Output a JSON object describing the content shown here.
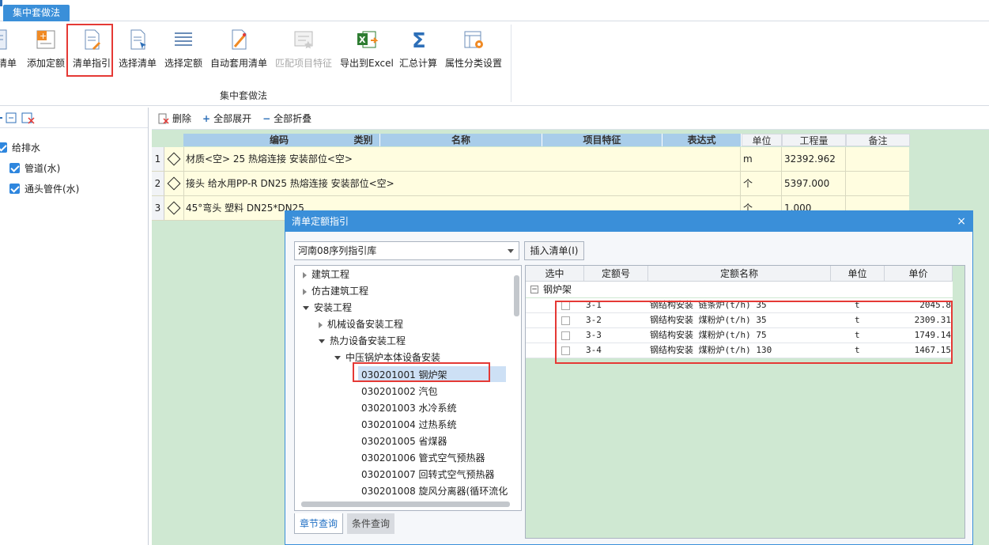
{
  "ribbon": {
    "tab": "集中套做法",
    "buttons": [
      {
        "label": "清单",
        "icon": "list-icon"
      },
      {
        "label": "添加定额",
        "icon": "add-quota-icon"
      },
      {
        "label": "清单指引",
        "icon": "list-guide-icon"
      },
      {
        "label": "选择清单",
        "icon": "select-list-icon"
      },
      {
        "label": "选择定额",
        "icon": "select-quota-icon"
      },
      {
        "label": "自动套用清单",
        "icon": "auto-apply-icon"
      },
      {
        "label": "匹配项目特征",
        "icon": "match-feature-icon"
      },
      {
        "label": "导出到Excel",
        "icon": "excel-icon"
      },
      {
        "label": "汇总计算",
        "icon": "sigma-icon"
      },
      {
        "label": "属性分类设置",
        "icon": "settings-table-icon"
      }
    ],
    "group_label": "集中套做法"
  },
  "left": {
    "items": [
      {
        "label": "给排水"
      },
      {
        "label": "管道(水)"
      },
      {
        "label": "通头管件(水)"
      }
    ]
  },
  "main": {
    "toolbar": {
      "delete": "删除",
      "expand": "全部展开",
      "collapse": "全部折叠"
    },
    "headers": {
      "code": "编码",
      "category": "类别",
      "name": "名称",
      "feature": "项目特征",
      "expr": "表达式",
      "unit": "单位",
      "qty": "工程量",
      "remark": "备注"
    },
    "rows": [
      {
        "num": "1",
        "name": "材质<空> 25 热熔连接 安装部位<空>",
        "unit": "m",
        "qty": "32392.962"
      },
      {
        "num": "2",
        "name": "接头 给水用PP-R DN25 热熔连接 安装部位<空>",
        "unit": "个",
        "qty": "5397.000"
      },
      {
        "num": "3",
        "name": "45°弯头 塑料 DN25*DN25",
        "unit": "个",
        "qty": "1.000"
      }
    ]
  },
  "dialog": {
    "title": "清单定额指引",
    "close": "×",
    "library": "河南08序列指引库",
    "insert": "插入清单(I)",
    "tree": {
      "n1": "建筑工程",
      "n2": "仿古建筑工程",
      "n3": "安装工程",
      "n4": "机械设备安装工程",
      "n5": "热力设备安装工程",
      "n6": "中压锅炉本体设备安装",
      "leaves": [
        "030201001  钢炉架",
        "030201002  汽包",
        "030201003  水冷系统",
        "030201004  过热系统",
        "030201005  省煤器",
        "030201006  管式空气预热器",
        "030201007  回转式空气预热器",
        "030201008  旋风分离器(循环流化"
      ]
    },
    "tabs": {
      "chapter": "章节查询",
      "condition": "条件查询"
    },
    "quota": {
      "headers": {
        "sel": "选中",
        "no": "定额号",
        "name": "定额名称",
        "unit": "单位",
        "price": "单价"
      },
      "group": "钢炉架",
      "group_toggle": "−",
      "rows": [
        {
          "no": "3-1",
          "name": "钢结构安装 链条炉(t/h) 35",
          "unit": "t",
          "price": "2045.8"
        },
        {
          "no": "3-2",
          "name": "钢结构安装 煤粉炉(t/h) 35",
          "unit": "t",
          "price": "2309.31"
        },
        {
          "no": "3-3",
          "name": "钢结构安装 煤粉炉(t/h) 75",
          "unit": "t",
          "price": "1749.14"
        },
        {
          "no": "3-4",
          "name": "钢结构安装 煤粉炉(t/h) 130",
          "unit": "t",
          "price": "1467.15"
        }
      ]
    }
  },
  "colors": {
    "accent": "#3a8fd9",
    "highlight": "#e53935",
    "row_bg": "#fffde0",
    "green_bg": "#cfe8d2"
  }
}
